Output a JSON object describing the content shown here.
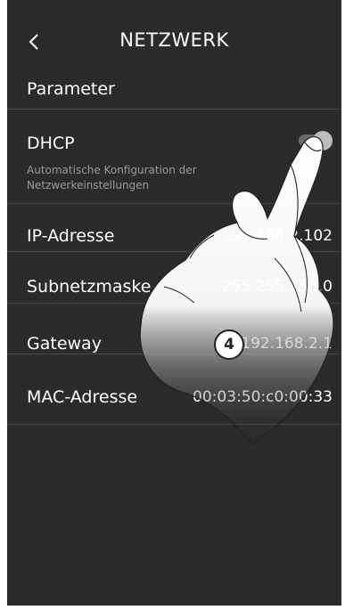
{
  "header": {
    "title": "NETZWERK",
    "back_icon": "chevron-left-icon"
  },
  "section": {
    "title": "Parameter"
  },
  "dhcp": {
    "label": "DHCP",
    "description": "Automatische Konfiguration der Netzwerkeinstellungen",
    "enabled": true
  },
  "rows": [
    {
      "label": "IP-Adresse",
      "value": "192.168.2.102"
    },
    {
      "label": "Subnetzmaske",
      "value": "255.255.255.0"
    },
    {
      "label": "Gateway",
      "value": "192.168.2.1"
    },
    {
      "label": "MAC-Adresse",
      "value": "00:03:50:c0:00:33"
    }
  ],
  "annotation": {
    "step_number": "4"
  },
  "colors": {
    "background": "#2b2b2b",
    "text": "#ffffff",
    "divider": "#4a4a4a",
    "hint": "#9a9a9a"
  }
}
